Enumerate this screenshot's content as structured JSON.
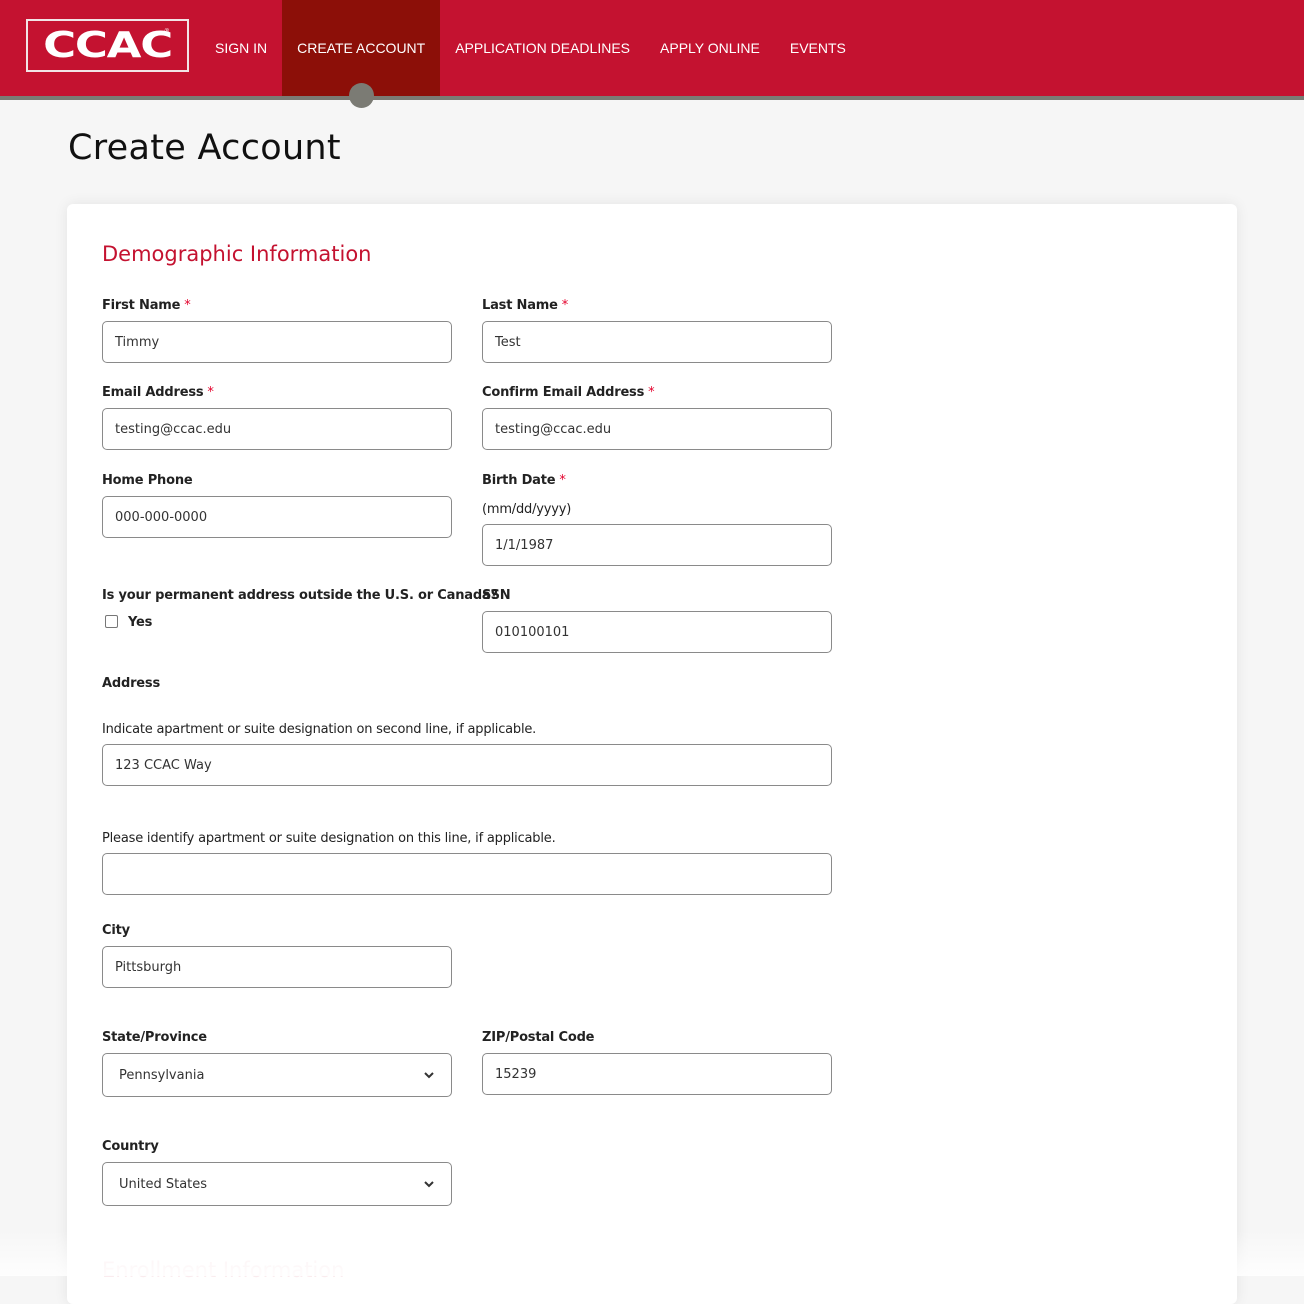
{
  "header": {
    "logo_text": "CCAC",
    "logo_mark": "®",
    "brand_color": "#c41230",
    "active_color": "#8c0f08",
    "nav": [
      {
        "label": "SIGN IN",
        "active": false
      },
      {
        "label": "CREATE ACCOUNT",
        "active": true
      },
      {
        "label": "APPLICATION DEADLINES",
        "active": false
      },
      {
        "label": "APPLY ONLINE",
        "active": false
      },
      {
        "label": "EVENTS",
        "active": false
      }
    ]
  },
  "page": {
    "title": "Create Account"
  },
  "form": {
    "section_title": "Demographic Information",
    "required_marker": "*",
    "first_name": {
      "label": "First Name",
      "value": "Timmy",
      "required": true
    },
    "last_name": {
      "label": "Last Name",
      "value": "Test",
      "required": true
    },
    "email": {
      "label": "Email Address",
      "value": "testing@ccac.edu",
      "required": true
    },
    "confirm_email": {
      "label": "Confirm Email Address",
      "value": "testing@ccac.edu",
      "required": true
    },
    "home_phone": {
      "label": "Home Phone",
      "value": "000-000-0000",
      "required": false
    },
    "birth_date": {
      "label": "Birth Date",
      "hint": "(mm/dd/yyyy)",
      "value": "1/1/1987",
      "required": true
    },
    "outside_us": {
      "label": "Is your permanent address outside the U.S. or Canada?",
      "option_label": "Yes",
      "checked": false
    },
    "ssn": {
      "label": "SSN",
      "value": "010100101"
    },
    "address": {
      "label": "Address",
      "line1_hint": "Indicate apartment or suite designation on second line, if applicable.",
      "line1_value": "123 CCAC Way",
      "line2_hint": "Please identify apartment or suite designation on this line, if applicable.",
      "line2_value": ""
    },
    "city": {
      "label": "City",
      "value": "Pittsburgh"
    },
    "state": {
      "label": "State/Province",
      "selected": "Pennsylvania"
    },
    "zip": {
      "label": "ZIP/Postal Code",
      "value": "15239"
    },
    "country": {
      "label": "Country",
      "selected": "United States"
    },
    "next_section_title": "Enrollment Information"
  }
}
